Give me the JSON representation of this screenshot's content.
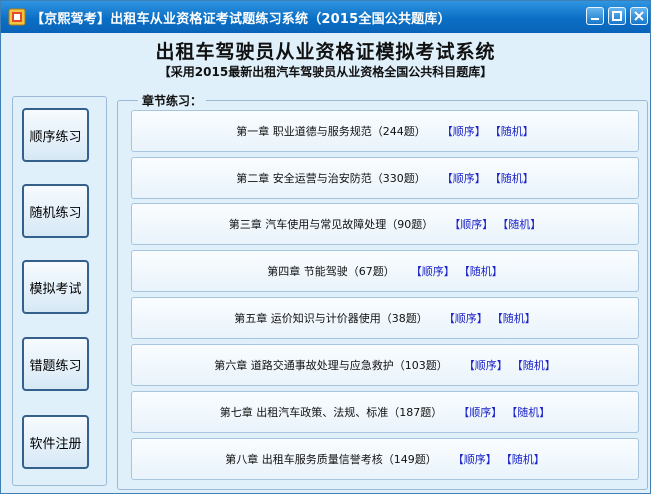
{
  "window": {
    "title": "【京熙驾考】出租车从业资格证考试题练习系统（2015全国公共题库）"
  },
  "header": {
    "title": "出租车驾驶员从业资格证模拟考试系统",
    "subtitle": "【采用2015最新出租汽车驾驶员从业资格全国公共科目题库】"
  },
  "sidebar": {
    "buttons": [
      {
        "label": "顺序练习"
      },
      {
        "label": "随机练习"
      },
      {
        "label": "模拟考试"
      },
      {
        "label": "错题练习"
      },
      {
        "label": "软件注册"
      }
    ]
  },
  "chapters": {
    "section_label": "章节练习：",
    "items": [
      {
        "text": "第一章 职业道德与服务规范（244题）",
        "seq": "【顺序】",
        "rand": "【随机】"
      },
      {
        "text": "第二章 安全运营与治安防范（330题）",
        "seq": "【顺序】",
        "rand": "【随机】"
      },
      {
        "text": "第三章 汽车使用与常见故障处理（90题）",
        "seq": "【顺序】",
        "rand": "【随机】"
      },
      {
        "text": "第四章 节能驾驶（67题）",
        "seq": "【顺序】",
        "rand": "【随机】"
      },
      {
        "text": "第五章 运价知识与计价器使用（38题）",
        "seq": "【顺序】",
        "rand": "【随机】"
      },
      {
        "text": "第六章 道路交通事故处理与应急救护（103题）",
        "seq": "【顺序】",
        "rand": "【随机】"
      },
      {
        "text": "第七章 出租汽车政策、法规、标准（187题）",
        "seq": "【顺序】",
        "rand": "【随机】"
      },
      {
        "text": "第八章 出租车服务质量信誉考核（149题）",
        "seq": "【顺序】",
        "rand": "【随机】"
      }
    ]
  }
}
